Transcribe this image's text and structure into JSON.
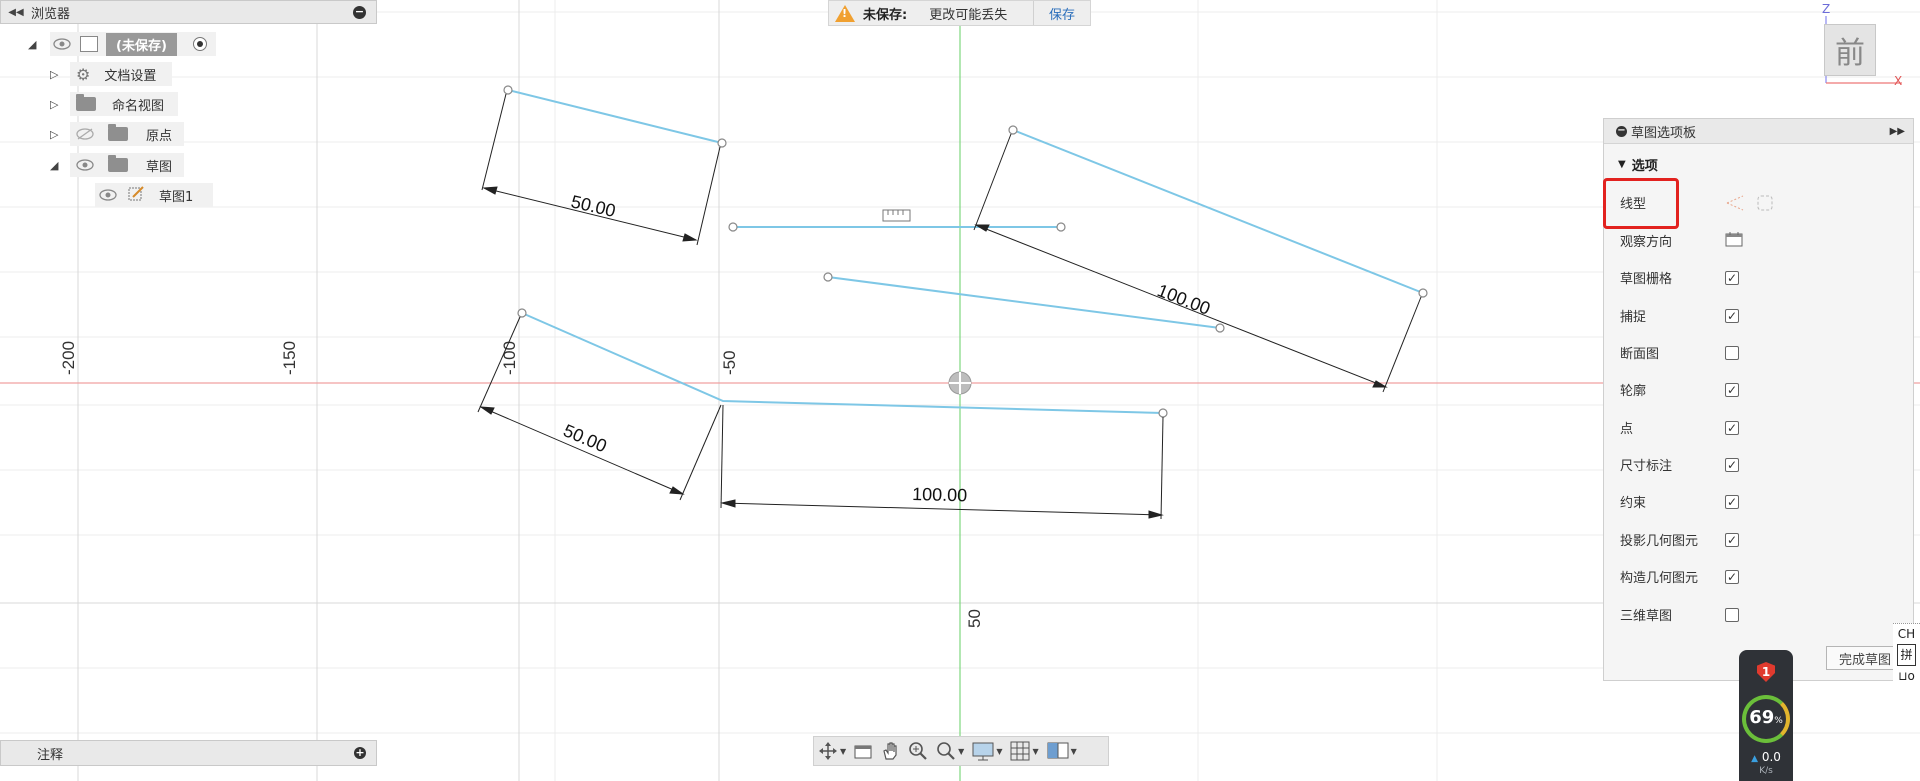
{
  "browser": {
    "title": "浏览器",
    "root_label": "(未保存)",
    "items": [
      {
        "label": "文档设置"
      },
      {
        "label": "命名视图"
      },
      {
        "label": "原点"
      },
      {
        "label": "草图"
      },
      {
        "label": "草图1"
      }
    ]
  },
  "unsaved_bar": {
    "label": "未保存:",
    "message": "更改可能丢失",
    "save": "保存"
  },
  "viewcube": {
    "face": "前",
    "axis_z": "Z",
    "axis_x": "X"
  },
  "canvas": {
    "ruler_labels": [
      "-200",
      "-150",
      "-100",
      "-50",
      "50"
    ],
    "dimensions": [
      "50.00",
      "100.00",
      "50.00",
      "100.00"
    ]
  },
  "sketch_palette": {
    "title": "草图选项板",
    "section": "选项",
    "options": [
      {
        "label": "线型",
        "control": "icons"
      },
      {
        "label": "观察方向",
        "control": "icon"
      },
      {
        "label": "草图栅格",
        "control": "checkbox",
        "checked": true
      },
      {
        "label": "捕捉",
        "control": "checkbox",
        "checked": true
      },
      {
        "label": "断面图",
        "control": "checkbox",
        "checked": false
      },
      {
        "label": "轮廓",
        "control": "checkbox",
        "checked": true
      },
      {
        "label": "点",
        "control": "checkbox",
        "checked": true
      },
      {
        "label": "尺寸标注",
        "control": "checkbox",
        "checked": true
      },
      {
        "label": "约束",
        "control": "checkbox",
        "checked": true
      },
      {
        "label": "投影几何图元",
        "control": "checkbox",
        "checked": true
      },
      {
        "label": "构造几何图元",
        "control": "checkbox",
        "checked": true
      },
      {
        "label": "三维草图",
        "control": "checkbox",
        "checked": false
      }
    ],
    "finish_button": "完成草图"
  },
  "annotation": {
    "title": "注释"
  },
  "ime": {
    "line1": "CH",
    "line2": "拼"
  },
  "security_widget": {
    "badge": "1",
    "percent": "69",
    "percent_unit": "%",
    "speed": "0.0",
    "speed_unit": "K/s"
  },
  "colors": {
    "sketch_line": "#7ec7e6",
    "x_axis": "#f0a0a0",
    "y_axis": "#7fd77f",
    "grid": "#ececec",
    "highlight": "#e2221f"
  }
}
